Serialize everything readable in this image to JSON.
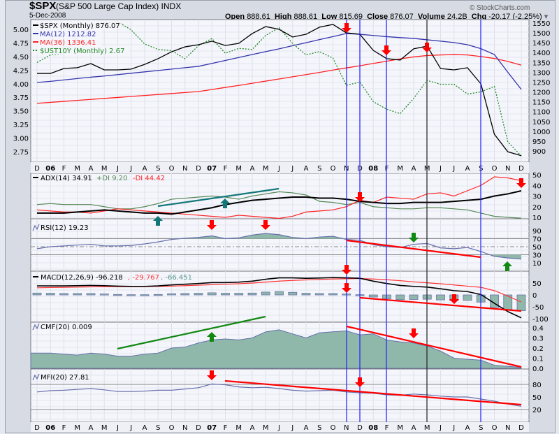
{
  "header": {
    "symbol": "$SPX",
    "name": "(S&P 500 Large Cap Index) INDX",
    "date": "5-Dec-2008",
    "open_label": "Open",
    "open": "888.61",
    "high_label": "High",
    "high": "888.61",
    "low_label": "Low",
    "low": "815.69",
    "close_label": "Close",
    "close": "876.07",
    "volume_label": "Volume",
    "volume": "24.2B",
    "chg_label": "Chg",
    "chg": "-20.17 (-2.25%)",
    "dropdown_icon": "▾",
    "copyright": "© StockCharts.com"
  },
  "legend": {
    "spx": "$SPX (Monthly) 876.07",
    "ma12": "MA(12) 1212.82",
    "ma36": "MA(36) 1336.41",
    "ust": "$UST10Y (Monthly) 2.67",
    "adx": "ADX(14) 34.91",
    "pdi": "+DI 9.20",
    "mdi": "-DI 44.42",
    "rsi": "RSI(12) 19.23",
    "macd": "MACD(12,26,9) -96.218",
    "macd_signal": ", -29.767",
    "macd_hist": ", -66.451",
    "cmf": "CMF(20) 0.009",
    "mfi": "MFI(20) 27.81"
  },
  "colors": {
    "spx": "#000000",
    "ma12": "#3333aa",
    "ma36": "#ff2222",
    "ust": "#228822",
    "pdi": "#558855",
    "mdi": "#ff2222",
    "fill": "#8fb8aa",
    "vline": "#2020ff",
    "arrow_red": "#ff0000",
    "arrow_green": "#118811",
    "arrow_teal": "#117777"
  },
  "chart_data": {
    "type": "line",
    "title": "$SPX (S&P 500 Large Cap Index) Monthly",
    "months": [
      "D",
      "06",
      "F",
      "M",
      "A",
      "M",
      "J",
      "J",
      "A",
      "S",
      "O",
      "N",
      "D",
      "07",
      "F",
      "M",
      "A",
      "M",
      "J",
      "J",
      "A",
      "S",
      "O",
      "N",
      "D",
      "08",
      "F",
      "M",
      "A",
      "M",
      "J",
      "J",
      "A",
      "S",
      "O",
      "N",
      "D"
    ],
    "price_ticks": [
      "1550",
      "1500",
      "1450",
      "1400",
      "1350",
      "1300",
      "1250",
      "1200",
      "1150",
      "1100",
      "1050",
      "1000",
      "950",
      "900"
    ],
    "yield_ticks": [
      "5.00",
      "4.75",
      "4.50",
      "4.25",
      "4.00",
      "3.75",
      "3.50",
      "3.25",
      "3.00",
      "2.75"
    ],
    "adx_ticks": [
      "50",
      "40",
      "30",
      "20",
      "10"
    ],
    "rsi_ticks": [
      "90",
      "70",
      "50",
      "30",
      "10"
    ],
    "macd_ticks": [
      "50",
      "0",
      "-50",
      "-100"
    ],
    "cmf_ticks": [
      "0.4",
      "0.3",
      "0.2",
      "0.1",
      "0.0"
    ],
    "mfi_ticks": [
      "80",
      "50",
      "20"
    ],
    "spx": [
      1294,
      1294,
      1319,
      1323,
      1344,
      1312,
      1312,
      1316,
      1340,
      1369,
      1404,
      1429,
      1440,
      1458,
      1436,
      1447,
      1497,
      1532,
      1518,
      1479,
      1493,
      1529,
      1543,
      1500,
      1493,
      1411,
      1369,
      1362,
      1419,
      1433,
      1319,
      1312,
      1323,
      1241,
      985,
      896,
      876
    ],
    "ma12": [
      1248,
      1254,
      1261,
      1268,
      1275,
      1281,
      1288,
      1295,
      1302,
      1309,
      1316,
      1323,
      1330,
      1345,
      1360,
      1375,
      1390,
      1405,
      1419,
      1435,
      1450,
      1466,
      1481,
      1497,
      1493,
      1487,
      1481,
      1476,
      1472,
      1465,
      1458,
      1451,
      1440,
      1420,
      1390,
      1300,
      1213
    ],
    "ma36": [
      1142,
      1147,
      1152,
      1157,
      1162,
      1167,
      1172,
      1177,
      1182,
      1187,
      1192,
      1197,
      1202,
      1212,
      1223,
      1233,
      1244,
      1255,
      1266,
      1277,
      1288,
      1299,
      1311,
      1322,
      1333,
      1345,
      1356,
      1368,
      1378,
      1385,
      1388,
      1390,
      1388,
      1380,
      1370,
      1355,
      1336
    ],
    "ust10y": [
      4.39,
      4.53,
      4.55,
      4.85,
      5.07,
      5.12,
      5.14,
      4.99,
      4.73,
      4.63,
      4.61,
      4.46,
      4.7,
      4.83,
      4.56,
      4.65,
      4.63,
      4.89,
      5.03,
      4.74,
      4.53,
      4.59,
      4.47,
      3.97,
      4.03,
      3.67,
      3.53,
      3.45,
      3.73,
      4.06,
      3.99,
      3.99,
      3.81,
      3.85,
      3.95,
      2.93,
      2.67
    ],
    "adx": [
      14,
      14,
      14,
      15,
      16,
      17,
      16,
      15,
      14,
      14,
      13,
      15,
      17,
      19,
      22,
      24,
      26,
      27,
      28,
      29,
      29,
      28,
      28,
      27,
      25,
      24,
      23,
      23,
      24,
      24,
      24,
      25,
      26,
      27,
      30,
      32,
      34.91
    ],
    "plus_di": [
      22,
      23,
      22,
      22,
      22,
      20,
      18,
      18,
      20,
      23,
      27,
      28,
      29,
      30,
      29,
      27,
      30,
      32,
      34,
      33,
      31,
      25,
      24,
      22,
      24,
      20,
      19,
      18,
      18,
      19,
      19,
      18,
      17,
      14,
      11,
      10,
      9.2
    ],
    "minus_di": [
      17,
      16,
      15,
      15,
      14,
      16,
      18,
      17,
      16,
      15,
      14,
      13,
      12,
      11,
      10,
      12,
      11,
      10,
      9,
      11,
      15,
      16,
      17,
      20,
      26,
      24,
      29,
      28,
      27,
      32,
      33,
      30,
      35,
      40,
      48,
      47,
      44.42
    ],
    "rsi": [
      45,
      50,
      52,
      54,
      56,
      52,
      52,
      53,
      57,
      62,
      68,
      71,
      73,
      77,
      70,
      72,
      79,
      83,
      80,
      73,
      70,
      74,
      76,
      68,
      66,
      55,
      50,
      48,
      56,
      58,
      47,
      45,
      48,
      38,
      26,
      22,
      19.23
    ],
    "macd": [
      38,
      38,
      38,
      39,
      40,
      39,
      37,
      36,
      36,
      38,
      42,
      45,
      48,
      52,
      52,
      54,
      58,
      66,
      72,
      72,
      70,
      71,
      73,
      72,
      70,
      58,
      48,
      40,
      36,
      33,
      26,
      18,
      14,
      2,
      -35,
      -70,
      -96.218
    ],
    "macd_signal": [
      30,
      31,
      32,
      33,
      34,
      35,
      35,
      35,
      35,
      36,
      37,
      39,
      41,
      43,
      45,
      47,
      50,
      54,
      58,
      61,
      63,
      65,
      67,
      68,
      69,
      67,
      64,
      60,
      55,
      51,
      47,
      42,
      37,
      32,
      18,
      -5,
      -29.767
    ],
    "cmf": [
      0.15,
      0.15,
      0.14,
      0.13,
      0.15,
      0.14,
      0.12,
      0.12,
      0.14,
      0.15,
      0.2,
      0.21,
      0.25,
      0.28,
      0.29,
      0.28,
      0.3,
      0.36,
      0.38,
      0.34,
      0.3,
      0.35,
      0.36,
      0.37,
      0.33,
      0.34,
      0.28,
      0.26,
      0.25,
      0.22,
      0.17,
      0.1,
      0.09,
      0.08,
      0.03,
      0.02,
      0.009
    ],
    "mfi": [
      62,
      65,
      66,
      68,
      70,
      67,
      63,
      63,
      64,
      66,
      66,
      69,
      72,
      81,
      79,
      74,
      72,
      73,
      70,
      66,
      64,
      65,
      66,
      62,
      60,
      59,
      55,
      54,
      57,
      55,
      52,
      50,
      50,
      45,
      40,
      33,
      27.81
    ],
    "yrange_price": [
      900,
      1550
    ],
    "yrange_yield": [
      2.75,
      5.0
    ],
    "grid": true,
    "legend_position": "top-left"
  }
}
